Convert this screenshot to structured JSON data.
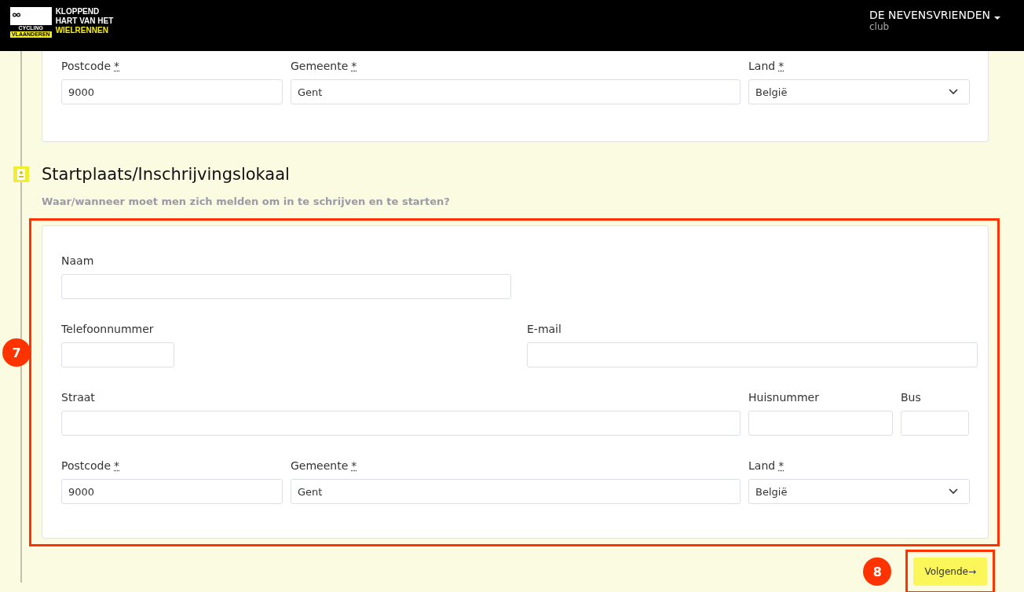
{
  "header": {
    "logo_badge": [
      "CYCLING",
      "VLAANDEREN"
    ],
    "logo_lines": [
      "KLOPPEND",
      "HART VAN HET"
    ],
    "logo_highlight": "WIELRENNEN",
    "user": {
      "name": "DE NEVENSVRIENDEN",
      "role": "club"
    }
  },
  "previous_card": {
    "fields": [
      {
        "kind": "text",
        "label": "Postcode",
        "required_mark": "*",
        "value": "9000"
      },
      {
        "kind": "text",
        "label": "Gemeente",
        "required_mark": "*",
        "value": "Gent"
      },
      {
        "kind": "select",
        "label": "Land",
        "required_mark": "*",
        "value": "België"
      }
    ]
  },
  "section": {
    "title": "Startplaats/Inschrijvingslokaal",
    "subtitle": "Waar/wanneer moet men zich melden om in te schrijven en te starten?",
    "fields": [
      {
        "kind": "text",
        "label": "Naam"
      },
      {
        "kind": "text",
        "label": "Telefoonnummer"
      },
      {
        "kind": "text",
        "label": "E-mail"
      },
      {
        "kind": "text",
        "label": "Straat"
      },
      {
        "kind": "text",
        "label": "Huisnummer"
      },
      {
        "kind": "text",
        "label": "Bus"
      },
      {
        "kind": "text",
        "label": "Postcode",
        "required_mark": "*",
        "value": "9000"
      },
      {
        "kind": "text",
        "label": "Gemeente",
        "required_mark": "*",
        "value": "Gent"
      },
      {
        "kind": "select",
        "label": "Land",
        "required_mark": "*",
        "value": "België"
      }
    ]
  },
  "annotations": [
    "7",
    "8"
  ],
  "next_button": {
    "label": "Volgende",
    "arrow": "→"
  }
}
